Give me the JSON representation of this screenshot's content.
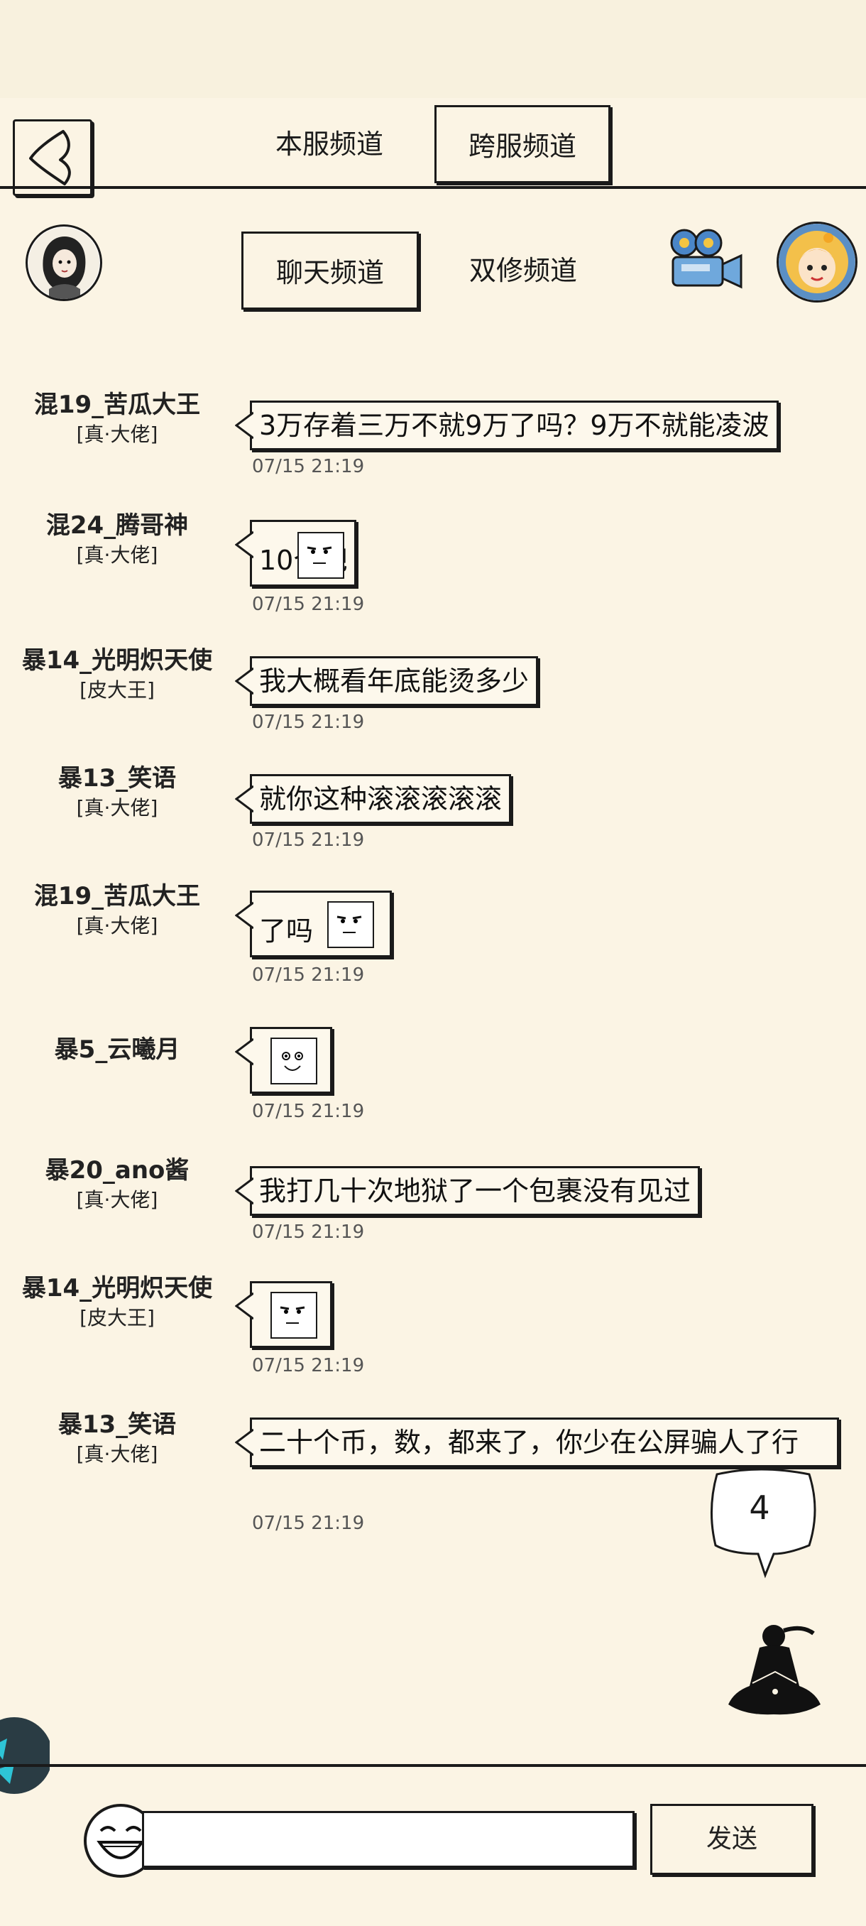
{
  "tabs_top": {
    "local": "本服频道",
    "cross": "跨服频道"
  },
  "tabs_sub": {
    "chat": "聊天频道",
    "dual": "双修频道"
  },
  "messages": [
    {
      "name": "混19_苦瓜大王",
      "title": "[真·大佬]",
      "text": "3万存着三万不就9万了吗？9万不就能凌波",
      "time": "07/15 21:19"
    },
    {
      "name": "混24_腾哥神",
      "title": "[真·大佬]",
      "text": "10个吧",
      "time": "07/15 21:19"
    },
    {
      "name": "暴14_光明炽天使",
      "title": "[皮大王]",
      "text": "我大概看年底能烫多少",
      "time": "07/15 21:19"
    },
    {
      "name": "暴13_笑语",
      "title": "[真·大佬]",
      "text": "就你这种滚滚滚滚滚",
      "time": "07/15 21:19"
    },
    {
      "name": "混19_苦瓜大王",
      "title": "[真·大佬]",
      "text": "了吗",
      "time": "07/15 21:19"
    },
    {
      "name": "暴5_云曦月",
      "title": "",
      "text": "",
      "time": "07/15 21:19"
    },
    {
      "name": "暴20_ano酱",
      "title": "[真·大佬]",
      "text": "我打几十次地狱了一个包裹没有见过",
      "time": "07/15 21:19"
    },
    {
      "name": "暴14_光明炽天使",
      "title": "[皮大王]",
      "text": "",
      "time": "07/15 21:19"
    },
    {
      "name": "暴13_笑语",
      "title": "[真·大佬]",
      "text": "二十个币，数，都来了，你少在公屏骗人了行",
      "time": "07/15 21:19"
    }
  ],
  "unread_badge": "4",
  "send_label": "发送",
  "icons": {
    "back": "back-arrow-icon",
    "camera": "video-camera-icon",
    "emoji": "laughing-face-icon",
    "meditate": "meditating-figure-icon"
  }
}
